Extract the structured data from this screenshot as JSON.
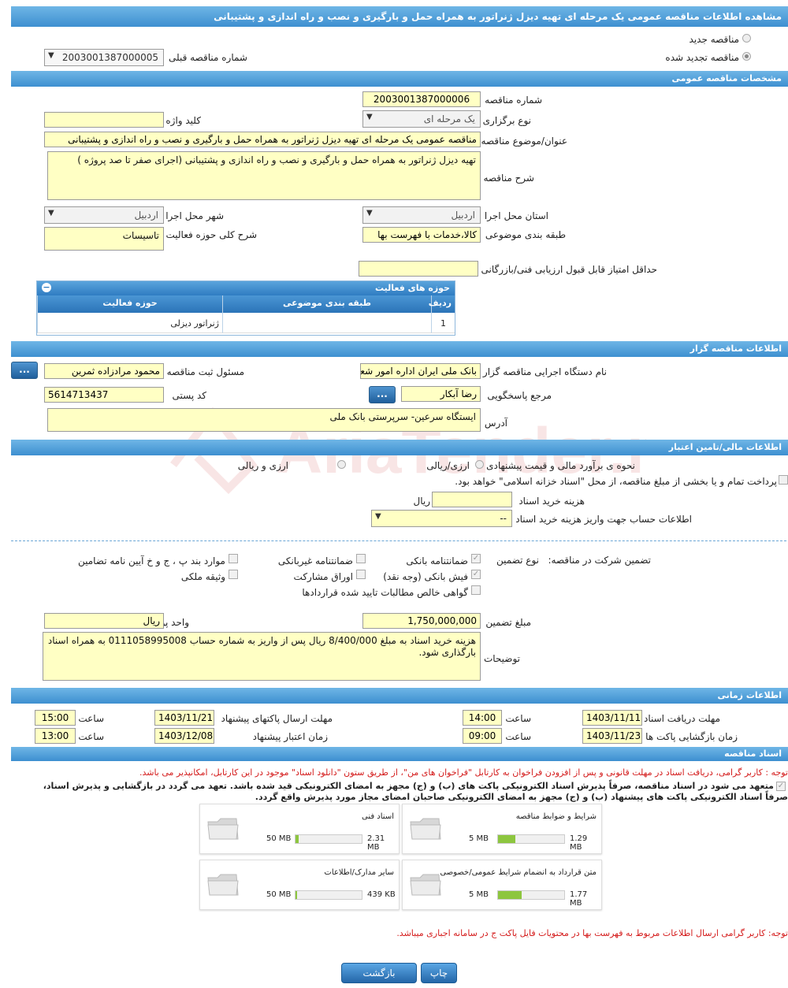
{
  "page_title": "مشاهده اطلاعات مناقصه عمومی یک مرحله ای تهیه دیزل ژنراتور به همراه حمل و بارگیری و نصب و راه اندازی و پشتیبانی",
  "tender_type": {
    "new_label": "مناقصه جدید",
    "renewed_label": "مناقصه تجدید شده",
    "prev_number_label": "شماره مناقصه قبلی",
    "prev_number_value": "2003001387000005"
  },
  "general": {
    "header": "مشخصات مناقصه عمومی",
    "number_label": "شماره مناقصه",
    "number_value": "2003001387000006",
    "holding_type_label": "نوع برگزاری",
    "holding_type_value": "یک مرحله ای",
    "keyword_label": "کلید واژه",
    "keyword_value": "",
    "title_label": "عنوان/موضوع مناقصه",
    "title_value": "مناقصه عمومی یک مرحله ای تهیه دیزل ژنراتور به همراه حمل و بارگیری و نصب و راه اندازی و پشتیبانی",
    "desc_label": "شرح مناقصه",
    "desc_value": "تهیه دیزل ژنراتور به همراه حمل و بارگیری و نصب و راه اندازی و پشتیبانی (اجرای صفر تا صد پروژه )",
    "province_label": "استان محل اجرا",
    "province_value": "اردبیل",
    "city_label": "شهر محل اجرا",
    "city_value": "اردبیل",
    "category_label": "طبقه بندی موضوعی",
    "category_value": "کالا،خدمات با فهرست بها",
    "activity_desc_label": "شرح کلی حوزه فعالیت",
    "activity_desc_value": "تاسیسات",
    "min_score_label": "حداقل امتیاز قابل قبول ارزیابی فنی/بازرگانی",
    "min_score_value": ""
  },
  "activity_grid": {
    "title": "حوزه های فعالیت",
    "columns": [
      "ردیف",
      "طبقه بندی موضوعی",
      "حوزه فعالیت"
    ],
    "rows": [
      [
        "1",
        "",
        "ژنراتور دیزلی"
      ]
    ]
  },
  "organizer": {
    "header": "اطلاعات مناقصه گزار",
    "agency_label": "نام دستگاه اجرایی مناقصه گزار",
    "agency_value": "بانک ملی ایران اداره امور شعب",
    "registrar_label": "مسئول ثبت مناقصه",
    "registrar_value": "محمود مرادزاده ثمرین",
    "reference_label": "مرجع پاسخگویی",
    "reference_value": "رضا آبکار",
    "postal_label": "کد پستی",
    "postal_value": "5614713437",
    "address_label": "آدرس",
    "address_value": "ایستگاه سرعین- سرپرستی بانک ملی",
    "dots": "..."
  },
  "finance": {
    "header": "اطلاعات مالی/تامین اعتبار",
    "estimate_label": "نحوه ی برآورد مالی و قیمت پیشنهادی",
    "opt1": "ارزی/ریالی",
    "opt2": "ارزی و ریالی",
    "treasury_text": "پرداخت تمام و یا بخشی از مبلغ مناقصه، از محل \"اسناد خزانه اسلامی\" خواهد بود.",
    "doc_fee_label": "هزینه خرید اسناد",
    "doc_fee_value": "",
    "doc_fee_unit": "ریال",
    "account_label": "اطلاعات حساب جهت واریز هزینه خرید اسناد",
    "account_value": "--"
  },
  "guarantee": {
    "label": "تضمین شرکت در مناقصه:",
    "type_label": "نوع تضمین",
    "options": [
      "ضمانتنامه بانکی",
      "ضمانتنامه غیربانکی",
      "موارد بند پ ، ج و خ آیین نامه تضامین",
      "فیش بانکی (وجه نقد)",
      "اوراق مشارکت",
      "وثیقه ملکی",
      "گواهی خالص مطالبات تایید شده قراردادها"
    ],
    "amount_label": "مبلغ تضمین",
    "amount_value": "1,750,000,000",
    "currency_label": "واحد پول",
    "currency_value": "ریال",
    "notes_label": "توضیحات",
    "notes_value": "هزینه خرید اسناد به مبلغ 8/400/000 ریال پس از واریز به شماره حساب 0111058995008 به همراه اسناد بارگذاری شود."
  },
  "timing": {
    "header": "اطلاعات زمانی",
    "receive_label": "مهلت دریافت اسناد",
    "receive_date": "1403/11/11",
    "receive_time": "14:00",
    "send_label": "مهلت ارسال پاکتهای پیشنهاد",
    "send_date": "1403/11/21",
    "send_time": "15:00",
    "open_label": "زمان بازگشایی پاکت ها",
    "open_date": "1403/11/23",
    "open_time": "09:00",
    "validity_label": "زمان اعتبار پیشنهاد",
    "validity_date": "1403/12/08",
    "validity_time": "13:00",
    "time_label": "ساعت"
  },
  "documents": {
    "header": "اسناد مناقصه",
    "note1": "توجه : کاربر گرامی، دریافت اسناد در مهلت قانونی و پس از افزودن فراخوان به کارتابل \"فراخوان های من\"، از طریق ستون \"دانلود اسناد\" موجود در این کارتابل، امکانپذیر می باشد.",
    "commit1": "متعهد می شود در اسناد مناقصه، صرفاً پذیرش اسناد الکترونیکی پاکت های (ب) و (ج) مجهز به امضای الکترونیکی قید شده باشد. تعهد می گردد در بازگشایی و پذیرش اسناد،",
    "commit2": "صرفاً اسناد الکترونیکی پاکت های پیشنهاد (ب) و (ج) مجهز به امضای الکترونیکی صاحبان امضای مجاز مورد پذیرش واقع گردد.",
    "cards": [
      {
        "title": "شرایط و ضوابط مناقصه",
        "current": "1.29 MB",
        "max": "5 MB",
        "ratio": 0.26
      },
      {
        "title": "اسناد فنی",
        "current": "2.31 MB",
        "max": "50 MB",
        "ratio": 0.046
      },
      {
        "title": "متن قرارداد به انضمام شرایط عمومی/خصوصی",
        "current": "1.77 MB",
        "max": "5 MB",
        "ratio": 0.354
      },
      {
        "title": "سایر مدارک/اطلاعات",
        "current": "439 KB",
        "max": "50 MB",
        "ratio": 0.009
      }
    ],
    "note2": "توجه: کاربر گرامی ارسال اطلاعات مربوط به فهرست بها در محتویات فایل پاکت ج در سامانه اجباری میباشد."
  },
  "footer": {
    "print_label": "چاپ",
    "back_label": "بازگشت"
  },
  "watermark_text": "AriaTender.neT",
  "colors": {
    "header_bar": "#3d8fd0",
    "field_bg": "#ffffc4",
    "button": "#2466a8",
    "progress": "#8dc63f",
    "note_red": "#d41b1b"
  }
}
